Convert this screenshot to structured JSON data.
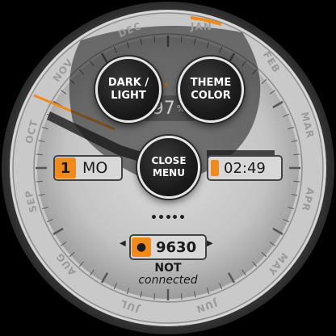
{
  "months": [
    "JAN",
    "FEB",
    "MAR",
    "APR",
    "MAY",
    "JUN",
    "JUL",
    "AUG",
    "SEP",
    "OCT",
    "NOV",
    "DEC"
  ],
  "buttons": {
    "dark_light": [
      "DARK /",
      "LIGHT"
    ],
    "theme_color": [
      "THEME",
      "COLOR"
    ],
    "close_menu": [
      "CLOSE",
      "MENU"
    ]
  },
  "battery": {
    "value": "97",
    "unit": "%"
  },
  "weekday": {
    "day": "1",
    "name": "MO"
  },
  "time": {
    "value": "02:49"
  },
  "steps": {
    "value": "9630"
  },
  "connection": {
    "status": "NOT",
    "detail": "connected"
  },
  "page_dots": 5,
  "colors": {
    "accent": "#f08a1a",
    "face": "#c8c8c8",
    "bezel": "#3e3e3e"
  }
}
